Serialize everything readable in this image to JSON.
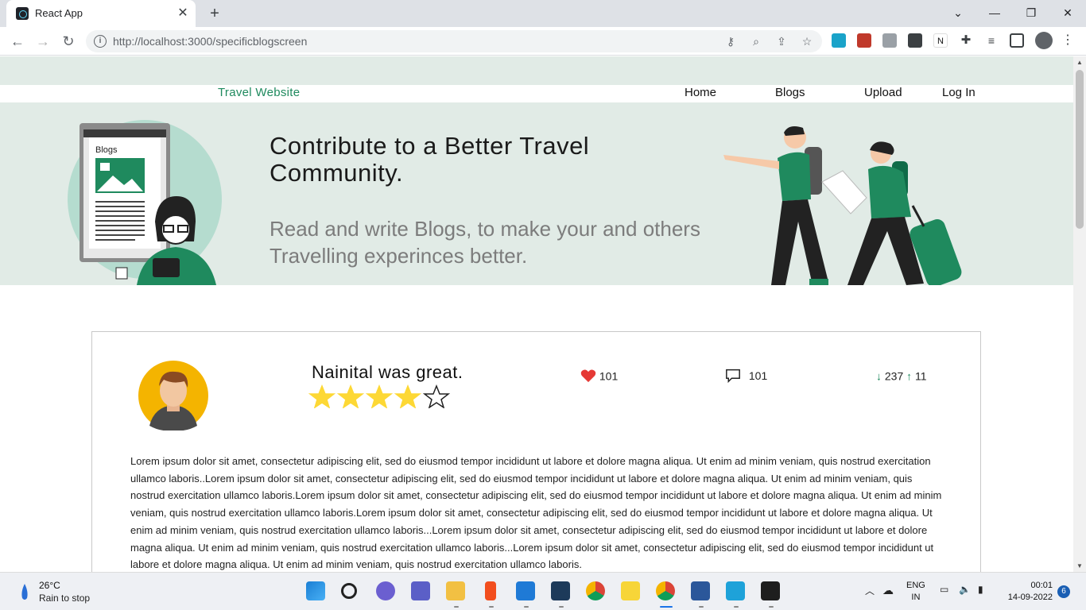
{
  "browser": {
    "tab_title": "React App",
    "url": "http://localhost:3000/specificblogscreen",
    "close_glyph": "✕",
    "newtab_glyph": "+"
  },
  "nav": {
    "brand": "Travel Website",
    "links": [
      "Home",
      "Blogs",
      "Upload",
      "Log In"
    ]
  },
  "hero": {
    "title": "Contribute to a Better Travel Community.",
    "subtitle": "Read and write Blogs, to make your and others Travelling experinces better.",
    "illustration_label": "Blogs",
    "accent_color": "#1f8a5e"
  },
  "blog": {
    "title": "Nainital was great.",
    "rating": 4,
    "rating_max": 5,
    "likes": "101",
    "comments": "101",
    "downvotes": "237",
    "upvotes": "11",
    "star_color": "#fdd835",
    "body": "Lorem ipsum dolor sit amet, consectetur adipiscing elit, sed do eiusmod tempor incididunt ut labore et dolore magna aliqua. Ut enim ad minim veniam, quis nostrud exercitation ullamco laboris..Lorem ipsum dolor sit amet, consectetur adipiscing elit, sed do eiusmod tempor incididunt ut labore et dolore magna aliqua. Ut enim ad minim veniam, quis nostrud exercitation ullamco laboris.Lorem ipsum dolor sit amet, consectetur adipiscing elit, sed do eiusmod tempor incididunt ut labore et dolore magna aliqua. Ut enim ad minim veniam, quis nostrud exercitation ullamco laboris.Lorem ipsum dolor sit amet, consectetur adipiscing elit, sed do eiusmod tempor incididunt ut labore et dolore magna aliqua. Ut enim ad minim veniam, quis nostrud exercitation ullamco laboris...Lorem ipsum dolor sit amet, consectetur adipiscing elit, sed do eiusmod tempor incididunt ut labore et dolore magna aliqua. Ut enim ad minim veniam, quis nostrud exercitation ullamco laboris...Lorem ipsum dolor sit amet, consectetur adipiscing elit, sed do eiusmod tempor incididunt ut labore et dolore magna aliqua. Ut enim ad minim veniam, quis nostrud exercitation ullamco laboris."
  },
  "taskbar": {
    "temperature": "26°C",
    "weather": "Rain to stop",
    "lang_line1": "ENG",
    "lang_line2": "IN",
    "time": "00:01",
    "date": "14-09-2022",
    "notifications": "6"
  }
}
